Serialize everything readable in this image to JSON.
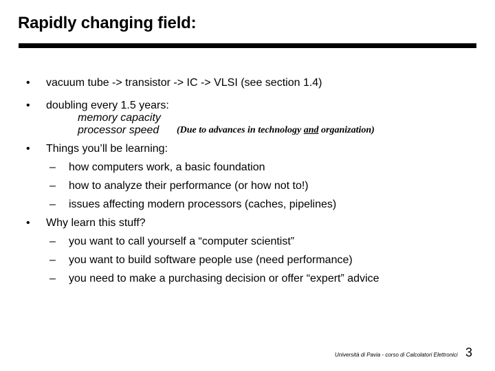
{
  "slide": {
    "title": "Rapidly changing field:",
    "bullets": [
      {
        "bullet": "•",
        "text": "vacuum tube -> transistor -> IC -> VLSI (see section 1.4)"
      },
      {
        "bullet": "•",
        "text": "doubling every 1.5 years:",
        "sub": [
          "memory capacity",
          "processor speed"
        ],
        "note": {
          "before": "(Due to advances in technology ",
          "underlined": "and",
          "after": " organization)"
        }
      },
      {
        "bullet": "•",
        "text": "Things you’ll be learning:",
        "sub": [
          {
            "dash": "–",
            "text": "how computers work, a basic foundation"
          },
          {
            "dash": "–",
            "text": "how to analyze their performance (or how not to!)"
          },
          {
            "dash": "–",
            "text": "issues affecting modern processors (caches, pipelines)"
          }
        ]
      },
      {
        "bullet": "•",
        "text": "Why learn this stuff?",
        "sub": [
          {
            "dash": "–",
            "text": "you want to call yourself a “computer scientist”"
          },
          {
            "dash": "–",
            "text": "you want to build software people use (need performance)"
          },
          {
            "dash": "–",
            "text": "you  need to make a purchasing decision or offer “expert” advice"
          }
        ]
      }
    ]
  },
  "footer": {
    "text": "Università di Pavia  - corso di Calcolatori Elettronici",
    "page_number": "3"
  }
}
